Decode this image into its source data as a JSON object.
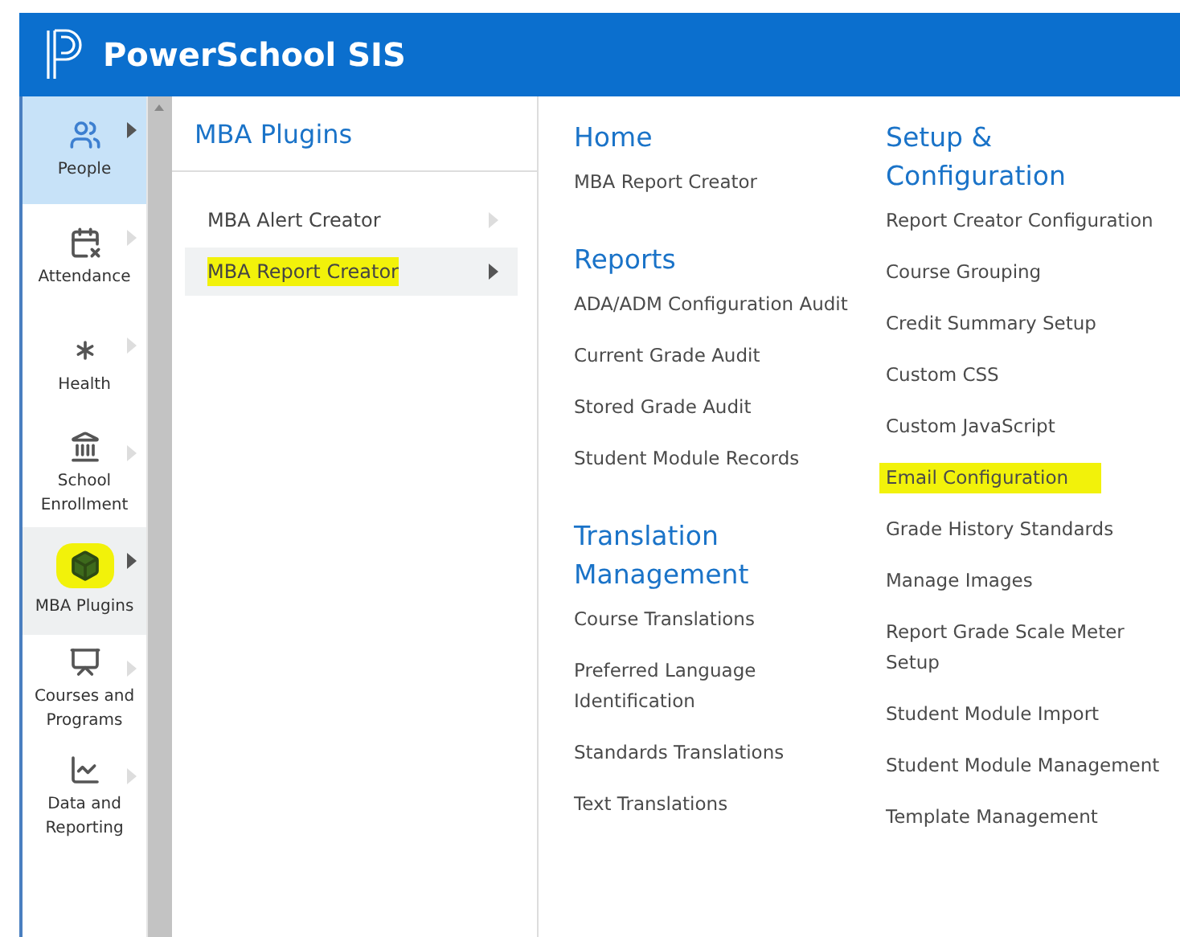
{
  "header": {
    "title": "PowerSchool SIS"
  },
  "sidebar": {
    "items": [
      {
        "label": "People",
        "selected": true,
        "open": false,
        "highlighted": false
      },
      {
        "label": "Attendance",
        "selected": false,
        "open": false,
        "highlighted": false
      },
      {
        "label": "Health",
        "selected": false,
        "open": false,
        "highlighted": false
      },
      {
        "label": "School Enrollment",
        "selected": false,
        "open": false,
        "highlighted": false
      },
      {
        "label": "MBA Plugins",
        "selected": false,
        "open": true,
        "highlighted": true
      },
      {
        "label": "Courses and Programs",
        "selected": false,
        "open": false,
        "highlighted": false
      },
      {
        "label": "Data and Reporting",
        "selected": false,
        "open": false,
        "highlighted": false
      }
    ]
  },
  "plugins_panel": {
    "title": "MBA Plugins",
    "items": [
      {
        "label": "MBA Alert Creator",
        "open": false,
        "highlighted": false
      },
      {
        "label": "MBA Report Creator",
        "open": true,
        "highlighted": true
      }
    ]
  },
  "flyout": {
    "columns": [
      {
        "sections": [
          {
            "heading": "Home",
            "links": [
              {
                "label": "MBA Report Creator",
                "highlighted": false
              }
            ]
          },
          {
            "heading": "Reports",
            "links": [
              {
                "label": "ADA/ADM Configuration Audit",
                "highlighted": false
              },
              {
                "label": "Current Grade Audit",
                "highlighted": false
              },
              {
                "label": "Stored Grade Audit",
                "highlighted": false
              },
              {
                "label": "Student Module Records",
                "highlighted": false
              }
            ]
          },
          {
            "heading": "Translation Management",
            "links": [
              {
                "label": "Course Translations",
                "highlighted": false
              },
              {
                "label": "Preferred Language Identification",
                "highlighted": false
              },
              {
                "label": "Standards Translations",
                "highlighted": false
              },
              {
                "label": "Text Translations",
                "highlighted": false
              }
            ]
          }
        ]
      },
      {
        "sections": [
          {
            "heading": "Setup & Configuration",
            "links": [
              {
                "label": "Report Creator Configuration",
                "highlighted": false
              },
              {
                "label": "Course Grouping",
                "highlighted": false
              },
              {
                "label": "Credit Summary Setup",
                "highlighted": false
              },
              {
                "label": "Custom CSS",
                "highlighted": false
              },
              {
                "label": "Custom JavaScript",
                "highlighted": false
              },
              {
                "label": "Email Configuration",
                "highlighted": true
              },
              {
                "label": "Grade History Standards",
                "highlighted": false
              },
              {
                "label": "Manage Images",
                "highlighted": false
              },
              {
                "label": "Report Grade Scale Meter Setup",
                "highlighted": false
              },
              {
                "label": "Student Module Import",
                "highlighted": false
              },
              {
                "label": "Student Module Management",
                "highlighted": false
              },
              {
                "label": "Template Management",
                "highlighted": false
              }
            ]
          }
        ]
      }
    ]
  }
}
